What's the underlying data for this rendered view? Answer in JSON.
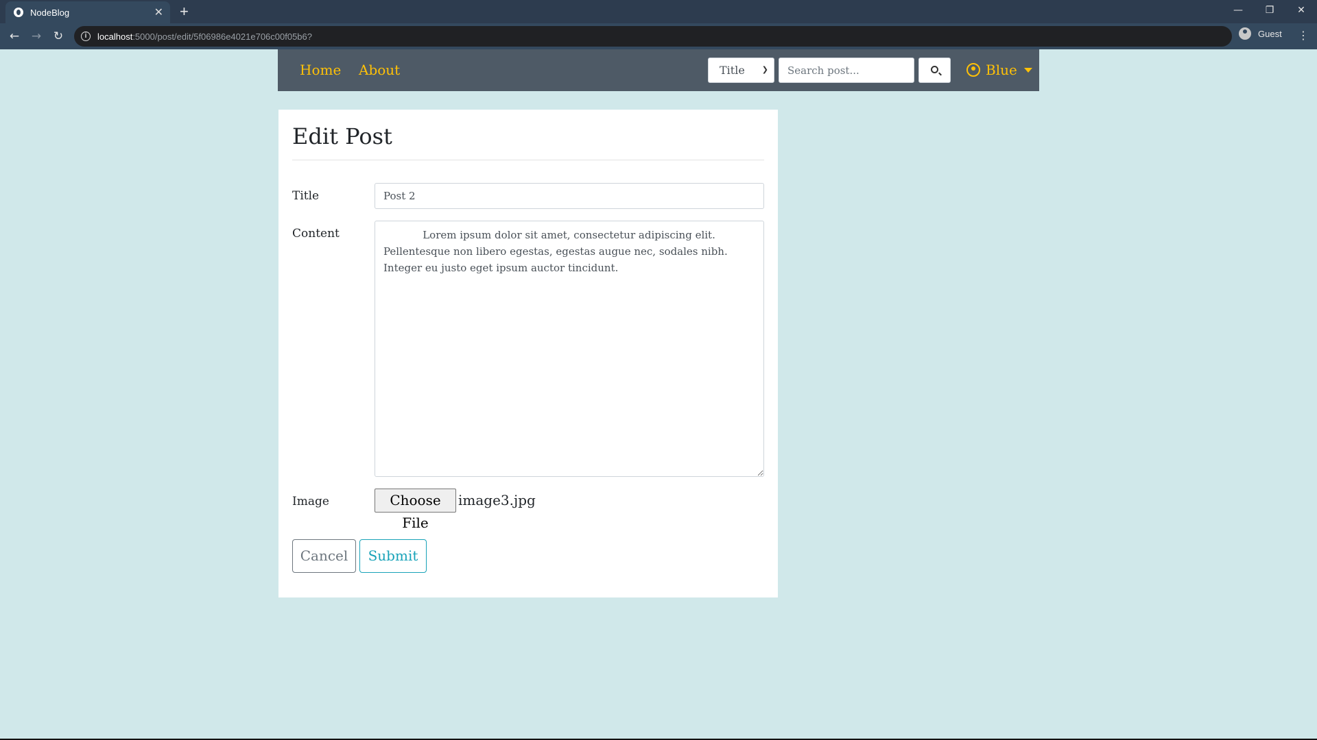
{
  "browser": {
    "tab_title": "NodeBlog",
    "tab_close": "✕",
    "new_tab": "+",
    "url_host": "localhost",
    "url_path": ":5000/post/edit/5f06986e4021e706c00f05b6?",
    "profile_label": "Guest",
    "window_controls": {
      "minimize": "—",
      "restore": "❐",
      "close": "✕"
    }
  },
  "navbar": {
    "links": [
      "Home",
      "About"
    ],
    "search_field_select": "Title",
    "search_placeholder": "Search post...",
    "user_name": "Blue",
    "accent_color": "#ffc107"
  },
  "form": {
    "heading": "Edit Post",
    "title_label": "Title",
    "title_value": "Post 2",
    "content_label": "Content",
    "content_value": "            Lorem ipsum dolor sit amet, consectetur adipiscing elit. Pellentesque non libero egestas, egestas augue nec, sodales nibh. Integer eu justo eget ipsum auctor tincidunt.",
    "image_label": "Image",
    "file_button": "Choose File",
    "file_name": "image3.jpg",
    "cancel_label": "Cancel",
    "submit_label": "Submit"
  },
  "icons": [
    "globe-icon",
    "info-icon",
    "back-arrow-icon",
    "forward-arrow-icon",
    "reload-icon",
    "profile-icon",
    "kebab-menu-icon",
    "search-icon",
    "user-circle-icon",
    "caret-down-icon"
  ],
  "colors": {
    "background": "#d0e8ea",
    "navbar": "#4e5a66",
    "submit": "#17a2b8",
    "cancel": "#6c757d"
  }
}
